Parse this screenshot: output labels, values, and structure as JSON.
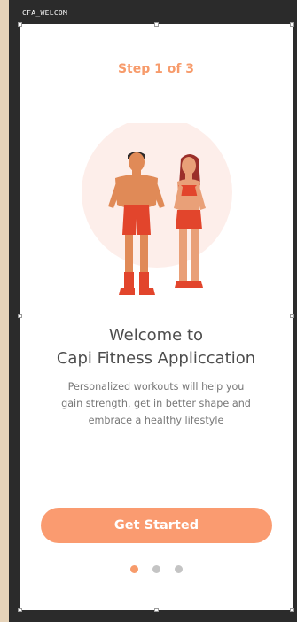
{
  "artboard": {
    "label": "CFA_WELCOM"
  },
  "onboarding": {
    "step_label": "Step 1 of 3",
    "title_lines": [
      "Welcome to",
      "Capi Fitness Appliccation"
    ],
    "subtitle_lines": [
      "Personalized workouts will help you",
      "gain strength, get in better shape and",
      "embrace a healthy lifestyle"
    ],
    "cta_label": "Get Started",
    "pagination": {
      "total": 3,
      "current": 1
    }
  },
  "hero": {
    "icon": "fitness-couple-illustration"
  },
  "colors": {
    "accent": "#f79b6b",
    "button": "#fa9b70",
    "hero_circle": "#fdeeea",
    "title": "#4d4d4d",
    "body_text": "#777777",
    "dot_inactive": "#c4c4c4",
    "canvas_bg": "#e6d3b9",
    "frame_bg": "#2b2b2b"
  }
}
